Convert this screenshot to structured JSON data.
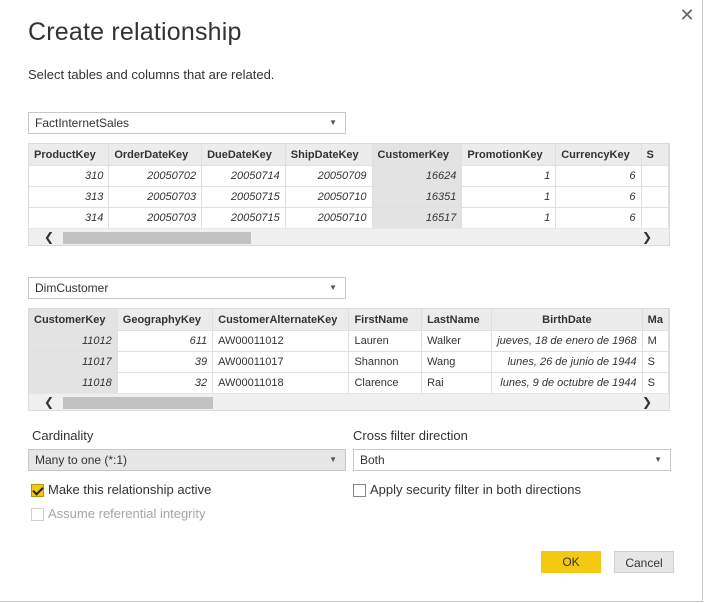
{
  "dialog": {
    "title": "Create relationship",
    "subtitle": "Select tables and columns that are related.",
    "close_icon": "✕"
  },
  "table1": {
    "selected_table": "FactInternetSales",
    "columns": [
      "ProductKey",
      "OrderDateKey",
      "DueDateKey",
      "ShipDateKey",
      "CustomerKey",
      "PromotionKey",
      "CurrencyKey",
      "S"
    ],
    "rows": [
      [
        "310",
        "20050702",
        "20050714",
        "20050709",
        "16624",
        "1",
        "6",
        ""
      ],
      [
        "313",
        "20050703",
        "20050715",
        "20050710",
        "16351",
        "1",
        "6",
        ""
      ],
      [
        "314",
        "20050703",
        "20050715",
        "20050710",
        "16517",
        "1",
        "6",
        ""
      ]
    ],
    "selected_column": "CustomerKey"
  },
  "table2": {
    "selected_table": "DimCustomer",
    "columns": [
      "CustomerKey",
      "GeographyKey",
      "CustomerAlternateKey",
      "FirstName",
      "LastName",
      "BirthDate",
      "Ma"
    ],
    "rows": [
      [
        "11012",
        "611",
        "AW00011012",
        "Lauren",
        "Walker",
        "jueves, 18 de enero de 1968",
        "M"
      ],
      [
        "11017",
        "39",
        "AW00011017",
        "Shannon",
        "Wang",
        "lunes, 26 de junio de 1944",
        "S"
      ],
      [
        "11018",
        "32",
        "AW00011018",
        "Clarence",
        "Rai",
        "lunes, 9 de octubre de 1944",
        "S"
      ]
    ],
    "selected_column": "CustomerKey"
  },
  "scroll": {
    "left_arrow": "❮",
    "right_arrow": "❯"
  },
  "cardinality": {
    "label": "Cardinality",
    "value": "Many to one (*:1)"
  },
  "cross_filter": {
    "label": "Cross filter direction",
    "value": "Both"
  },
  "options": {
    "active_label": "Make this relationship active",
    "active_checked": true,
    "referential_label": "Assume referential integrity",
    "referential_checked": false,
    "security_label": "Apply security filter in both directions",
    "security_checked": false
  },
  "buttons": {
    "ok": "OK",
    "cancel": "Cancel"
  },
  "colors": {
    "accent": "#f2c811",
    "selected_column": "#e3e3e3"
  }
}
